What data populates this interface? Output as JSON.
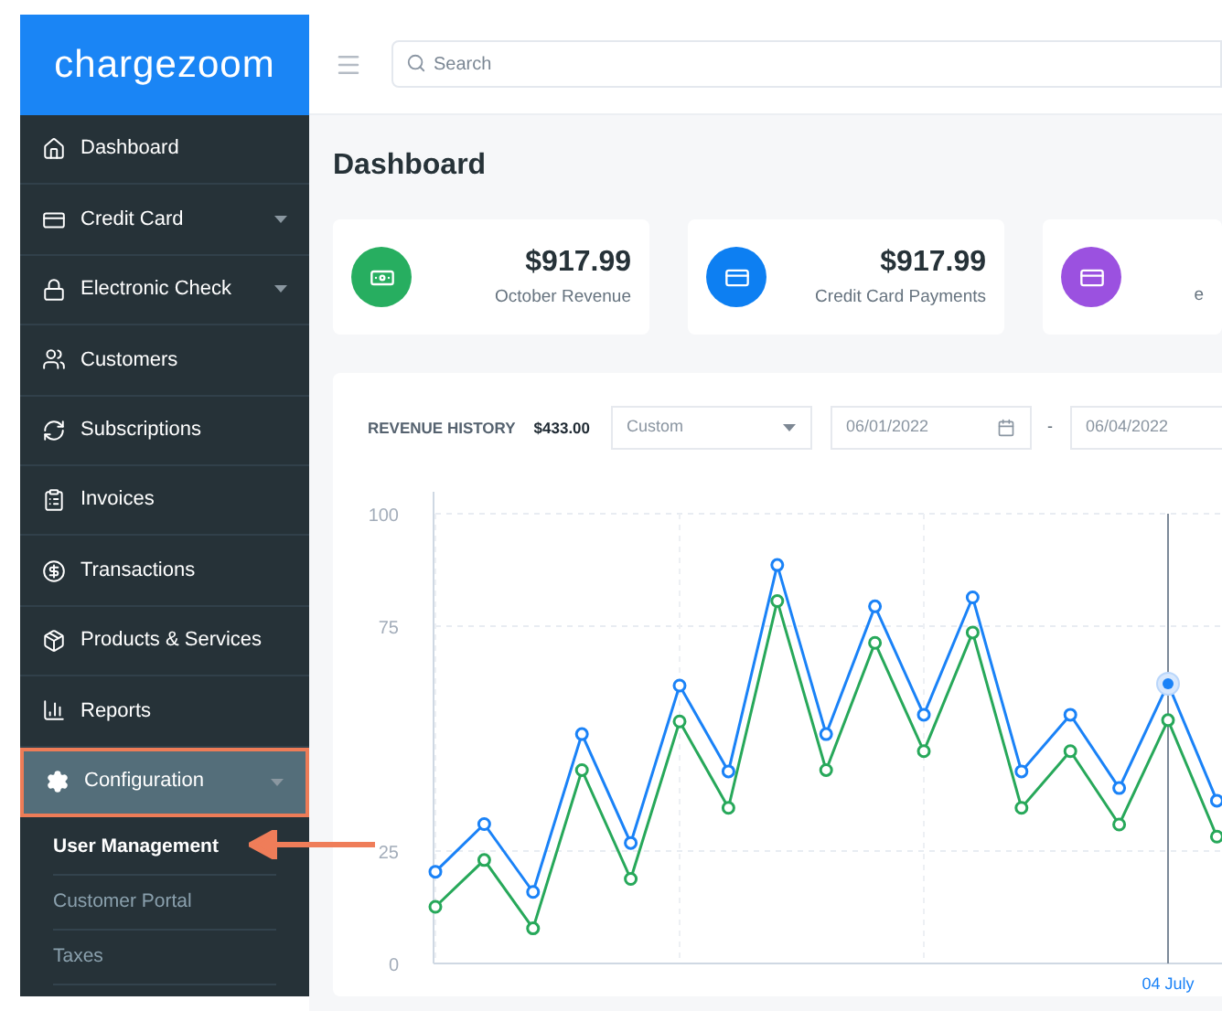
{
  "logo": "chargezoom",
  "sidebar": {
    "items": [
      {
        "label": "Dashboard",
        "selected": false,
        "kind": "link"
      },
      {
        "label": "Credit Card",
        "selected": false,
        "kind": "group"
      },
      {
        "label": "Electronic Check",
        "selected": false,
        "kind": "group"
      },
      {
        "label": "Customers",
        "selected": false,
        "kind": "link"
      },
      {
        "label": "Subscriptions",
        "selected": false,
        "kind": "link"
      },
      {
        "label": "Invoices",
        "selected": false,
        "kind": "link"
      },
      {
        "label": "Transactions",
        "selected": false,
        "kind": "link"
      },
      {
        "label": "Products & Services",
        "selected": false,
        "kind": "link"
      },
      {
        "label": "Reports",
        "selected": false,
        "kind": "link"
      },
      {
        "label": "Configuration",
        "selected": true,
        "kind": "group",
        "children": [
          {
            "label": "User Management",
            "selected": true
          },
          {
            "label": "Customer Portal",
            "selected": false
          },
          {
            "label": "Taxes",
            "selected": false
          }
        ]
      }
    ]
  },
  "header": {
    "search": {
      "placeholder": "Search"
    }
  },
  "page_title": "Dashboard",
  "cards": [
    {
      "amount": "$917.99",
      "label": "October Revenue",
      "color": "#27ae60"
    },
    {
      "amount": "$917.99",
      "label": "Credit Card Payments",
      "color": "#0d7ff2"
    },
    {
      "label": "e",
      "color": "#9b51e0"
    }
  ],
  "revenue_history": {
    "title": "REVENUE HISTORY",
    "total": "$433.00",
    "range_select": "Custom",
    "start_date": "06/01/2022",
    "separator": "-",
    "end_date": "06/04/2022",
    "chart_data": {
      "type": "line",
      "grid": true,
      "ylim": [
        0,
        100
      ],
      "yticks": [
        0,
        25,
        75,
        100
      ],
      "series": [
        {
          "color": "#1a82f7",
          "marker": "circle",
          "values": [
            20.4,
            31,
            15.9,
            51,
            26.8,
            61.8,
            42.7,
            88.6,
            51,
            79.4,
            55.3,
            81.4,
            42.7,
            55.3,
            39,
            62.2,
            36.2
          ]
        },
        {
          "color": "#27a85a",
          "marker": "circle",
          "values": [
            12.6,
            23,
            7.8,
            43,
            18.8,
            53.8,
            34.6,
            80.6,
            43,
            71.3,
            47.2,
            73.6,
            34.6,
            47.2,
            30.9,
            54.1,
            28.2
          ]
        }
      ],
      "annotations": [
        {
          "text": "04 July"
        }
      ]
    }
  }
}
